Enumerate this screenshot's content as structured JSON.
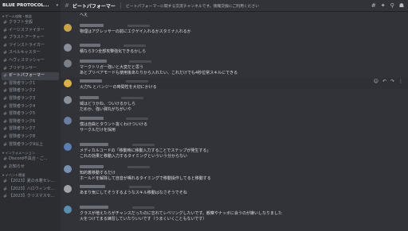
{
  "sidebar": {
    "server_name": "BLUE PROTOCOL...",
    "category_game": "ゲーム攻略・雑談",
    "channels": [
      {
        "label": "クラフト全般",
        "active": false
      },
      {
        "label": "イージスファイター",
        "active": false
      },
      {
        "label": "ブラストアーチャー",
        "active": false
      },
      {
        "label": "ツインストライカー",
        "active": false
      },
      {
        "label": "スペルキャスター",
        "active": false
      },
      {
        "label": "ヘヴィスマッシャー",
        "active": false
      },
      {
        "label": "ブリゲランサー",
        "active": false
      },
      {
        "label": "ビートパフォーマー",
        "active": true
      },
      {
        "label": "冒険者ランク1",
        "active": false
      },
      {
        "label": "冒険者ランク2",
        "active": false
      },
      {
        "label": "冒険者ランク3",
        "active": false
      },
      {
        "label": "冒険者ランク4",
        "active": false
      },
      {
        "label": "冒険者ランク5",
        "active": false
      },
      {
        "label": "冒険者ランク6",
        "active": false
      },
      {
        "label": "冒険者ランク7",
        "active": false
      },
      {
        "label": "冒険者ランク8",
        "active": false
      },
      {
        "label": "冒険者ランク9以上",
        "active": false
      }
    ],
    "category_info": "インフォメーション",
    "info_channels": [
      {
        "label": "Discord不具合・ご..."
      },
      {
        "label": "お知らせ"
      }
    ],
    "category_event": "イベント関連",
    "event_channels": [
      {
        "label": "【2023】夏の水着セレ..."
      },
      {
        "label": "【2023】ハロウィンセ..."
      },
      {
        "label": "【2023】クリスマスセ..."
      }
    ]
  },
  "header": {
    "channel_name": "ビートパフォーマー",
    "topic": "ビートパフォーマーに関する交流チャンネルです。情報交換にご利用ください"
  },
  "messages": [
    {
      "lines": [
        "へえ"
      ]
    },
    {
      "lines": [
        "物理はアグレッサーの前にエクゲイ入れるかスタミナ入れるか"
      ]
    },
    {
      "lines": [
        "積なら3つ全部攻撃強化できるかしら"
      ]
    },
    {
      "lines": [
        "マークトリガー強いと大変だと思う",
        "あとプリペアモードも使用後あたりから入れたい、これだけでも4秒位常スキルにできる"
      ]
    },
    {
      "lines": [
        "火力% とバンジーの時間性を大切にかける"
      ]
    },
    {
      "lines": [
        "域はどうかね、ついけるかしら",
        "だめか、強い弾丸がちがいや"
      ]
    },
    {
      "lines": [
        "僕は自曲とタウント抜くわけついける",
        "サークルだけを採用"
      ]
    },
    {
      "lines": [
        "メディカルコードの「移動時に移動入力することでステップが発生する」",
        "これの効果と移動入力するタイミングといういう分からない"
      ]
    },
    {
      "lines": [
        "知的着移動するだけ",
        "ホールドを解除して自音が鳴れるタイミングで移動操作してると移動する"
      ]
    },
    {
      "lines": [
        "あまり気にしてそうするようなスキル移動はなさそうでそね"
      ]
    },
    {
      "lines": [
        "クラスが増えたらがチャンスだったのに忘れてレベリングしたいです。観察やナッボに会うのが嫌いしなりました",
        "火をつけてまる練習していたりいいです（うまくいくこともないです）"
      ]
    }
  ]
}
